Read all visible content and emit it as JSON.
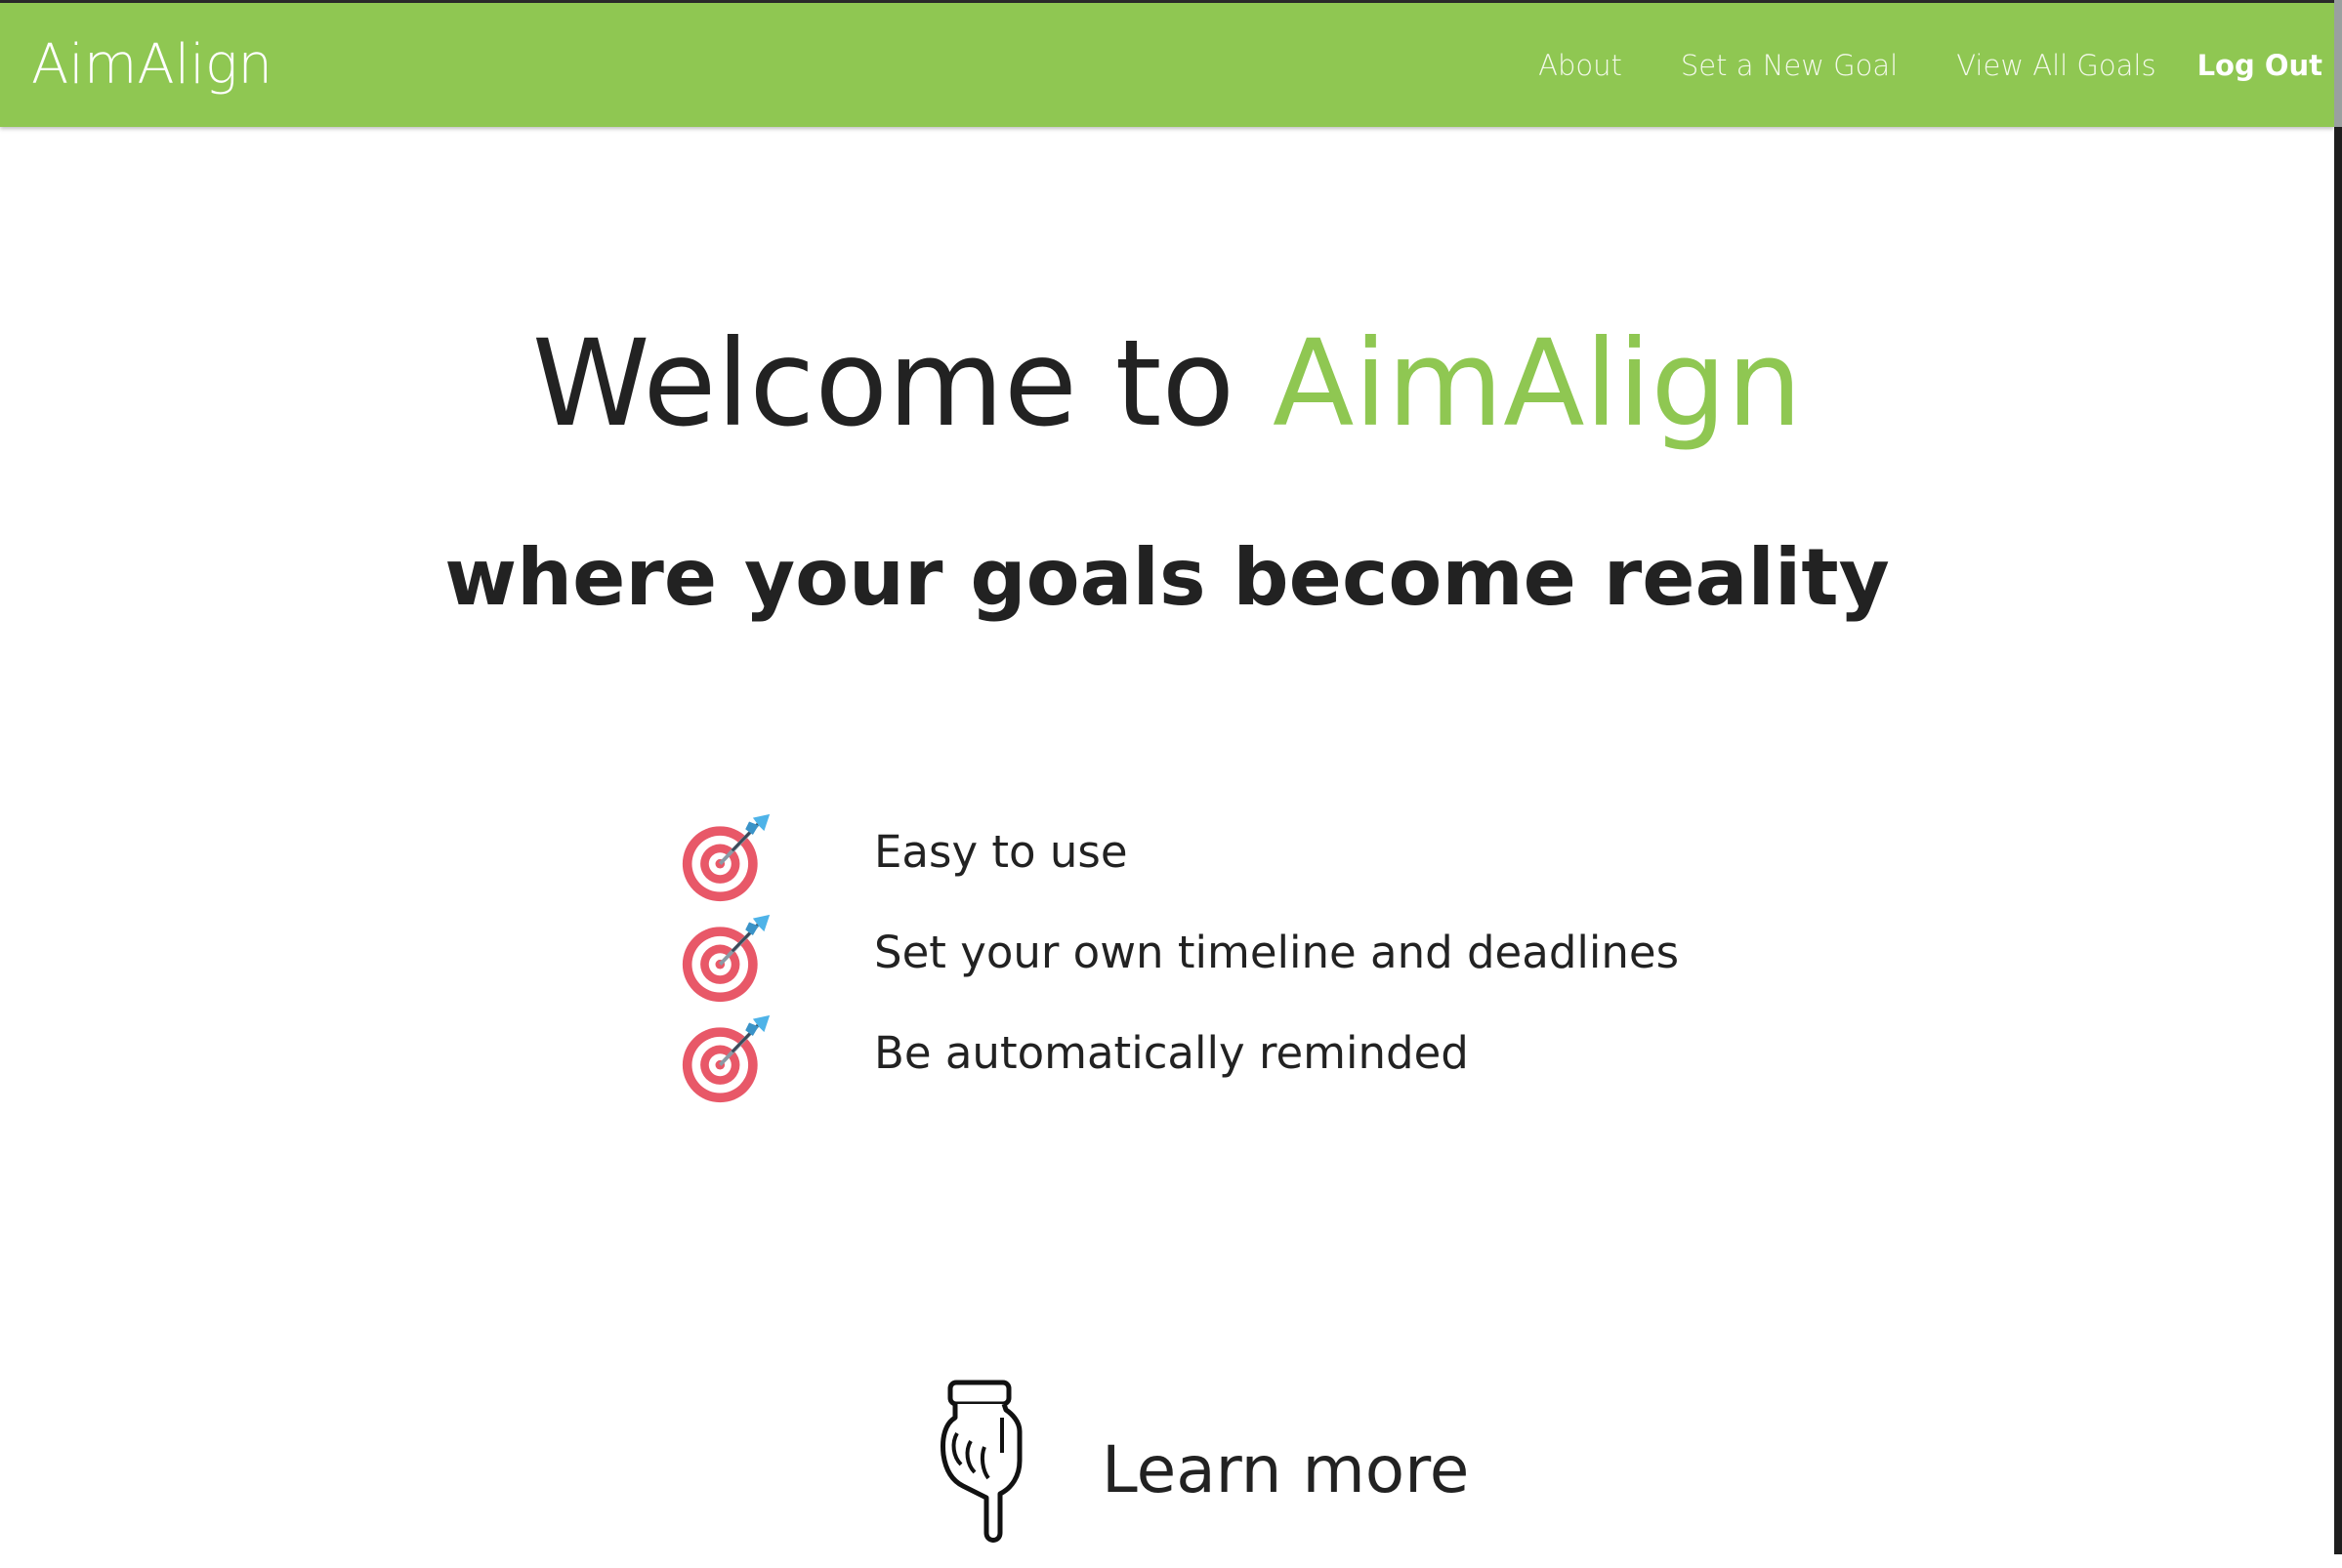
{
  "navbar": {
    "brand": "AimAlign",
    "links": [
      {
        "label": "About"
      },
      {
        "label": "Set a New Goal"
      },
      {
        "label": "View All Goals"
      },
      {
        "label": "Log Out"
      }
    ],
    "background_color": "#8fc752"
  },
  "hero": {
    "title_prefix": "Welcome to ",
    "title_accent": "AimAlign",
    "subtitle": "where your goals become reality",
    "accent_color": "#8fc752"
  },
  "features": [
    {
      "icon": "dart-target-icon",
      "label": "Easy to use"
    },
    {
      "icon": "dart-target-icon",
      "label": "Set your own timeline and deadlines"
    },
    {
      "icon": "dart-target-icon",
      "label": "Be automatically reminded"
    }
  ],
  "learn_more": {
    "icon": "pointing-down-hand-icon",
    "label": "Learn more"
  }
}
